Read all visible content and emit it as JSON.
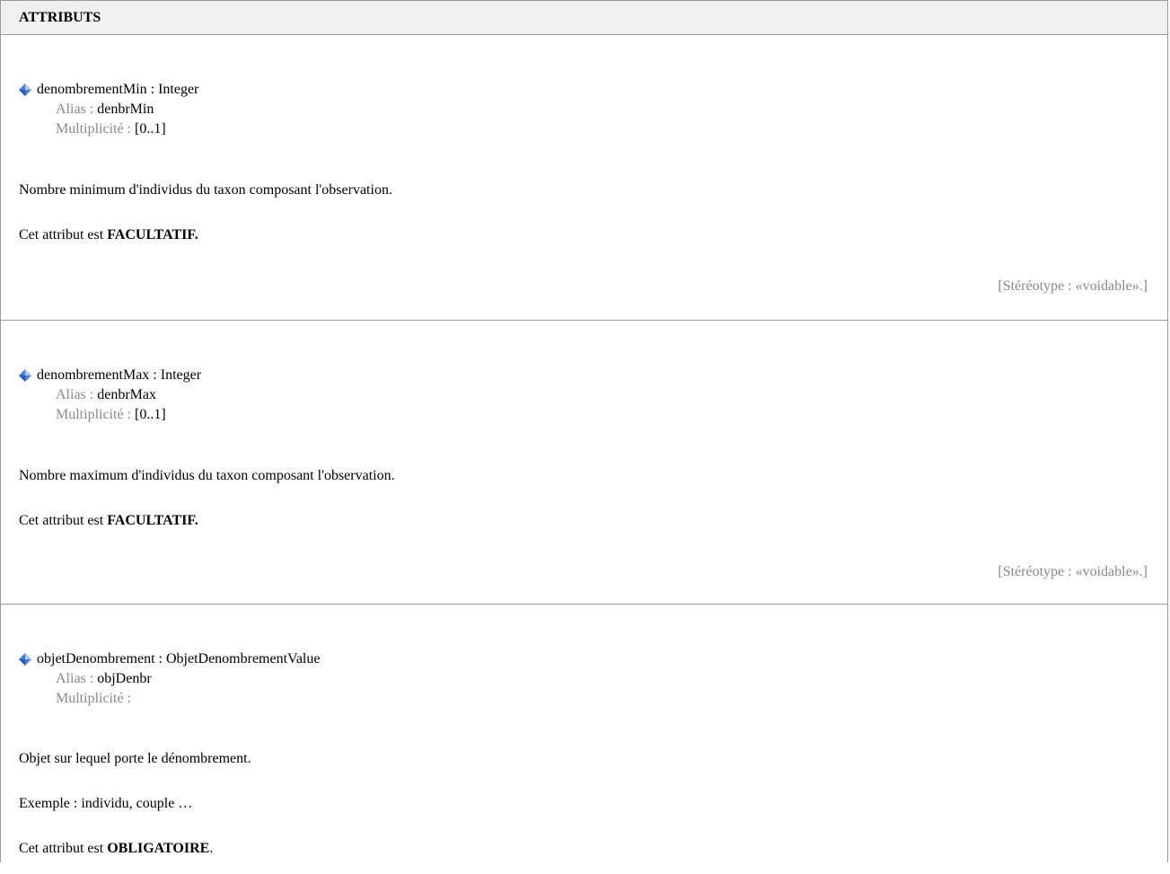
{
  "section": {
    "title": "ATTRIBUTS"
  },
  "labels": {
    "alias": "Alias : ",
    "multiplicity": "Multiplicité : "
  },
  "attributes": [
    {
      "signature": "denombrementMin : Integer",
      "alias": "denbrMin",
      "multiplicity": "[0..1]",
      "description": "Nombre minimum d'individus du taxon composant l'observation.",
      "status_prefix": "Cet attribut est ",
      "status_value": "FACULTATIF.",
      "stereotype": "[Stéréotype : «voidable».]"
    },
    {
      "signature": "denombrementMax : Integer",
      "alias": "denbrMax",
      "multiplicity": "[0..1]",
      "description": "Nombre maximum d'individus du taxon composant l'observation.",
      "status_prefix": "Cet attribut est ",
      "status_value": "FACULTATIF.",
      "stereotype": "[Stéréotype : «voidable».]"
    },
    {
      "signature": "objetDenombrement : ObjetDenombrementValue",
      "alias": "objDenbr",
      "multiplicity": "",
      "description": "Objet sur lequel porte le dénombrement.",
      "example": "Exemple : individu, couple …",
      "status_prefix": "Cet attribut est ",
      "status_value": "OBLIGATOIRE",
      "status_suffix": "."
    }
  ],
  "icons": {
    "attribute": "blue-gem-icon"
  },
  "colors": {
    "border": "#999999",
    "header_bg": "#f0f0f0",
    "label": "#888888",
    "gem": "#4a7fd4"
  }
}
